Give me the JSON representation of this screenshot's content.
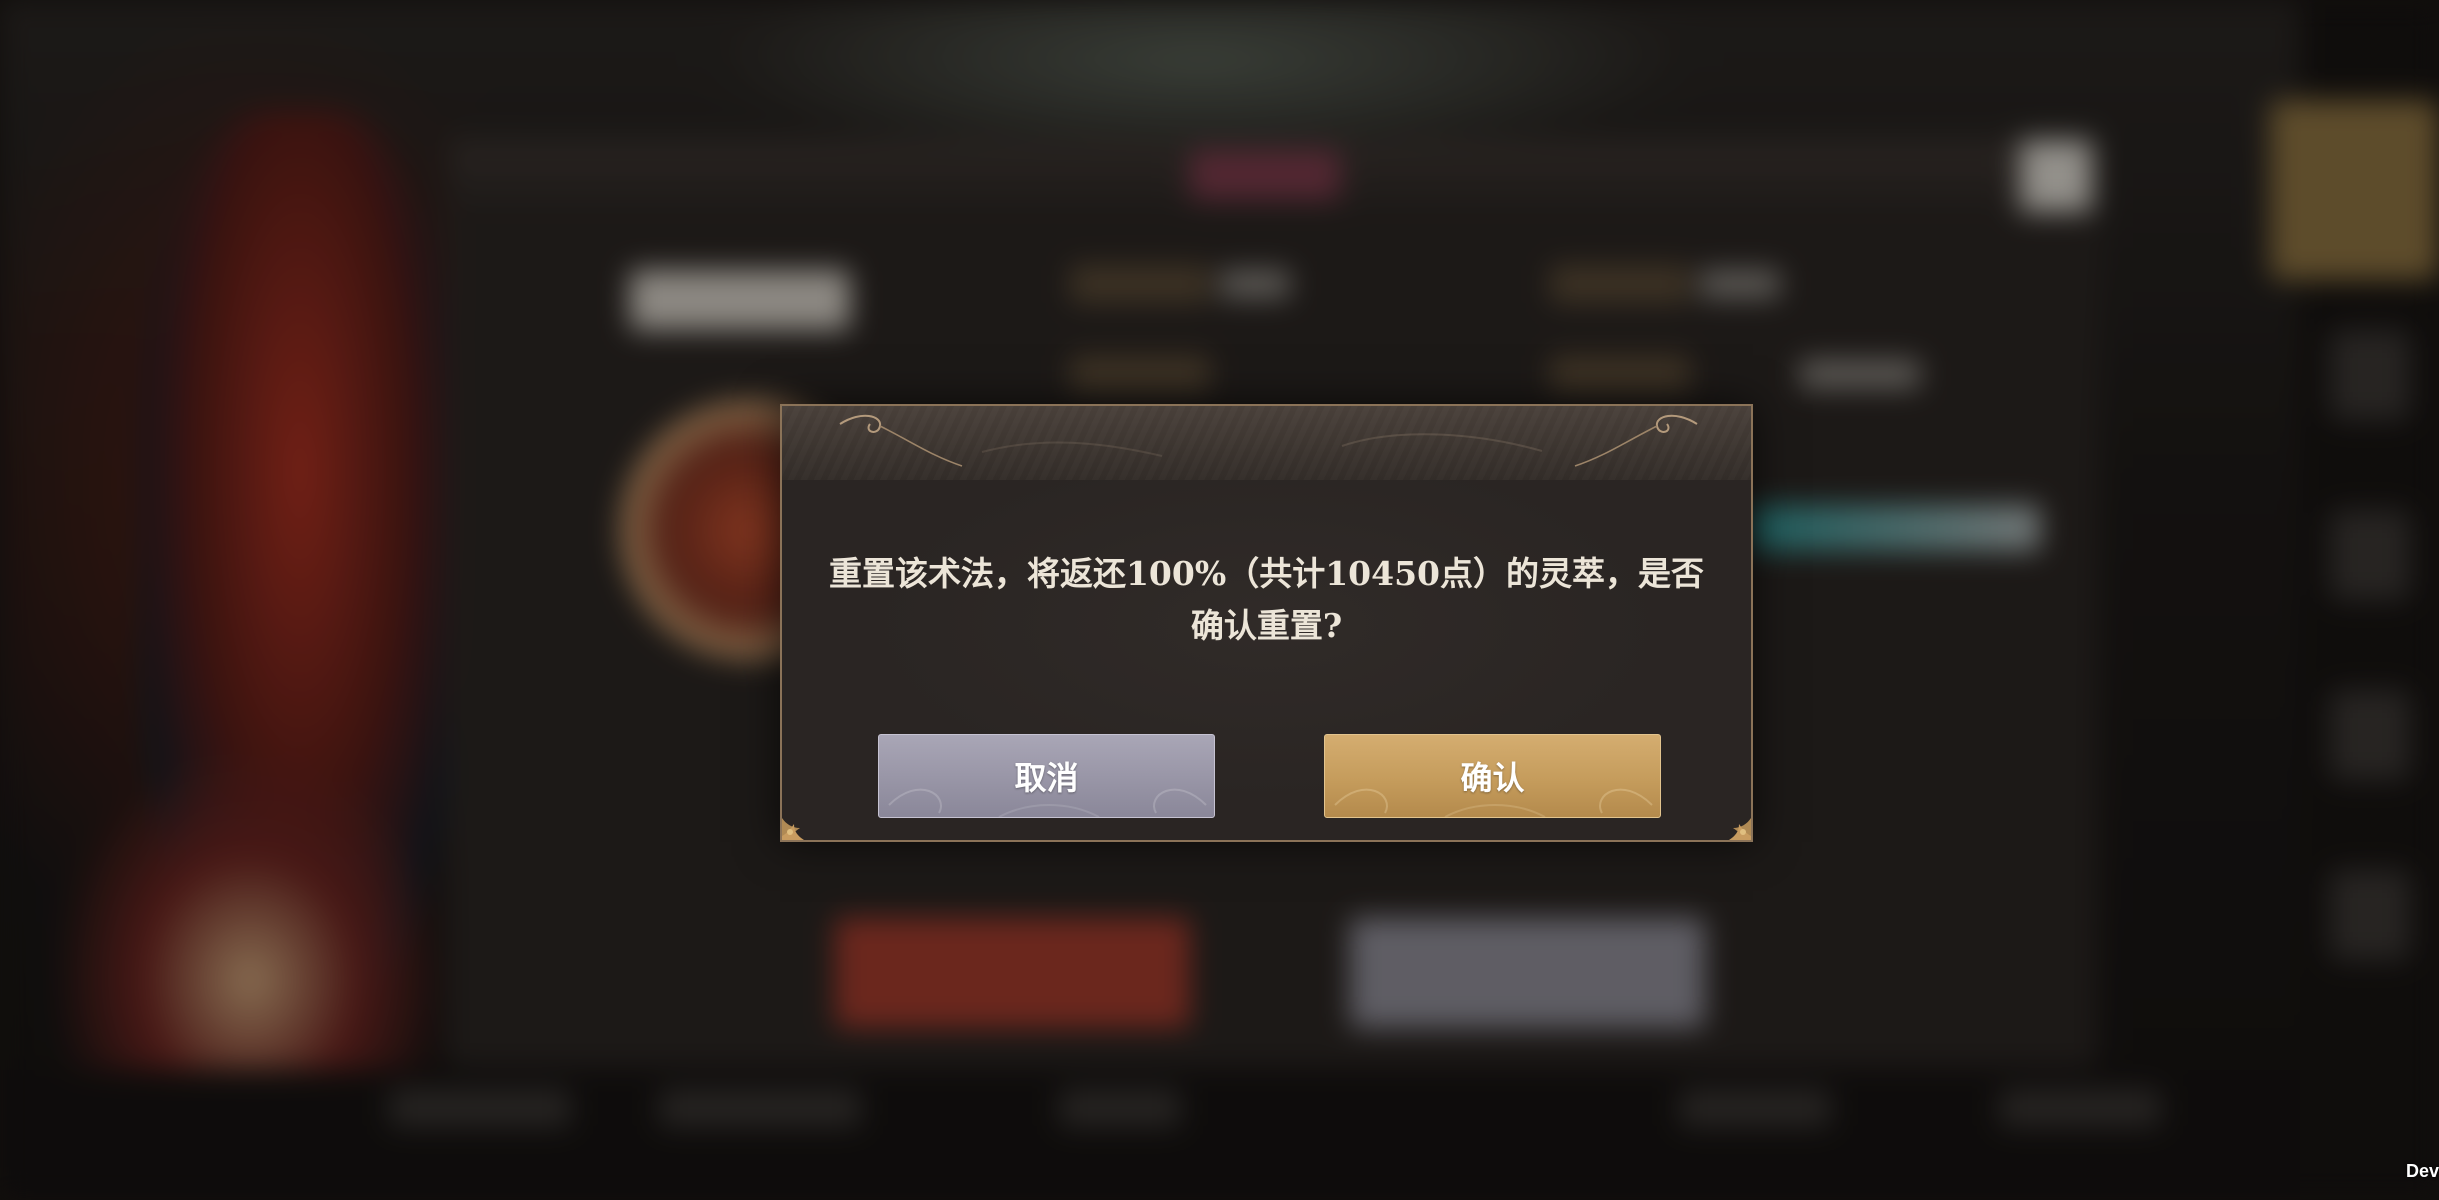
{
  "dialog": {
    "message_line1": "重置该术法，将返还100%（共计10450点）的灵萃，是否",
    "message_line2": "确认重置?",
    "cancel_label": "取消",
    "confirm_label": "确认"
  },
  "corner_text": "Dev",
  "colors": {
    "cancel_button": "#9b98a9",
    "confirm_button": "#c9a062",
    "dialog_border": "#8b7358",
    "dialog_background": "#2a2523",
    "message_text": "#ece5d8"
  }
}
